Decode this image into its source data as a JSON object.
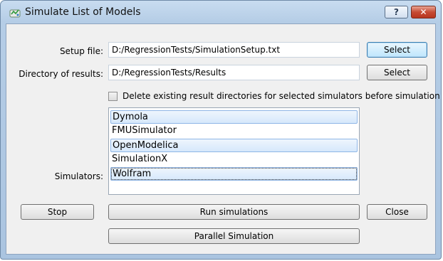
{
  "window": {
    "title": "Simulate List of Models",
    "help_label": "?",
    "close_label": "✕"
  },
  "setup": {
    "label": "Setup file:",
    "value": "D:/RegressionTests/SimulationSetup.txt",
    "button": "Select"
  },
  "results_dir": {
    "label": "Directory of results:",
    "value": "D:/RegressionTests/Results",
    "button": "Select"
  },
  "delete_option": {
    "label": "Delete existing result directories for selected simulators before simulation",
    "checked": false
  },
  "simulators": {
    "label": "Simulators:",
    "items": [
      {
        "name": "Dymola",
        "selected": true
      },
      {
        "name": "FMUSimulator",
        "selected": false
      },
      {
        "name": "OpenModelica",
        "selected": true
      },
      {
        "name": "SimulationX",
        "selected": false
      },
      {
        "name": "Wolfram",
        "selected": true
      }
    ]
  },
  "actions": {
    "stop": "Stop",
    "run": "Run simulations",
    "close": "Close",
    "parallel": "Parallel Simulation"
  }
}
